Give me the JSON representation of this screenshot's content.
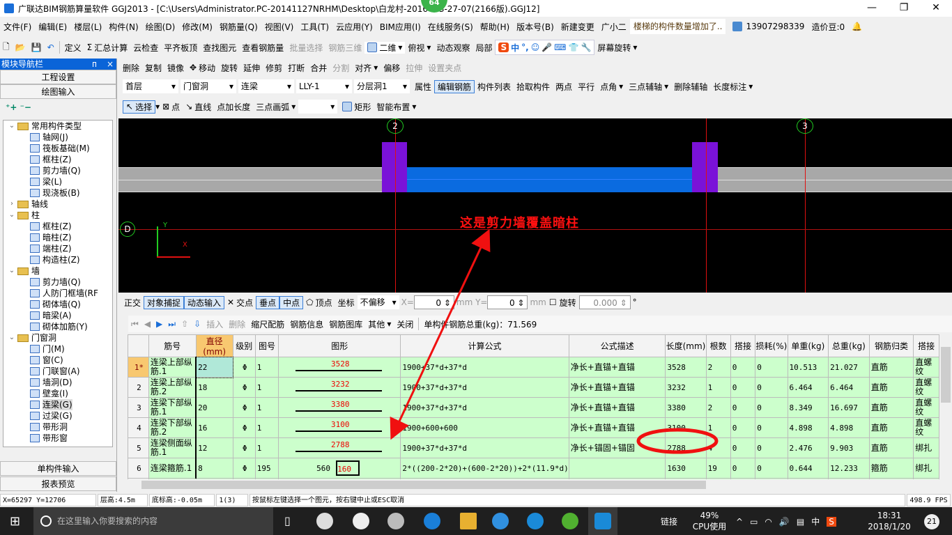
{
  "title": "广联达BIM钢筋算量软件 GGJ2013 - [C:\\Users\\Administrator.PC-20141127NRHM\\Desktop\\白龙村-2016    -13-27-07(2166版).GGJ12]",
  "badge": "64",
  "menu": [
    "文件(F)",
    "编辑(E)",
    "楼层(L)",
    "构件(N)",
    "绘图(D)",
    "修改(M)",
    "钢筋量(Q)",
    "视图(V)",
    "工具(T)",
    "云应用(Y)",
    "BIM应用(I)",
    "在线服务(S)",
    "帮助(H)",
    "版本号(B)",
    "新建变更",
    "广小二"
  ],
  "notice": "楼梯的构件数量增加了..",
  "user": "13907298339",
  "bean": "造价豆:0",
  "toolbar1": [
    "定义",
    "汇总计算",
    "云检查",
    "平齐板顶",
    "查找图元",
    "查看钢筋量",
    "批量选择",
    "钢筋三维",
    "二维",
    "俯视",
    "动态观察",
    "局部",
    "屏幕旋转"
  ],
  "ime": [
    "中",
    "°,"
  ],
  "toolbar2": [
    "删除",
    "复制",
    "镜像",
    "移动",
    "旋转",
    "延伸",
    "修剪",
    "打断",
    "合并",
    "分割",
    "对齐",
    "偏移",
    "拉伸",
    "设置夹点"
  ],
  "selectors": [
    "首层",
    "门窗洞",
    "连梁",
    "LLY-1",
    "分层洞1"
  ],
  "toolbar3": [
    "属性",
    "编辑钢筋",
    "构件列表",
    "拾取构件",
    "两点",
    "平行",
    "点角",
    "三点辅轴",
    "删除辅轴",
    "长度标注"
  ],
  "toolbar4": [
    "选择",
    "点",
    "直线",
    "点加长度",
    "三点画弧",
    "矩形",
    "智能布置"
  ],
  "nav": {
    "title": "模块导航栏",
    "pin": "ᴨ",
    "close": "×",
    "btn1": "工程设置",
    "btn2": "绘图输入",
    "btn3": "单构件输入",
    "btn4": "报表预览",
    "tree": [
      {
        "t": "常用构件类型",
        "lv": 0,
        "folder": true,
        "open": true
      },
      {
        "t": "轴网(J)",
        "lv": 1
      },
      {
        "t": "筏板基础(M)",
        "lv": 1
      },
      {
        "t": "框柱(Z)",
        "lv": 1
      },
      {
        "t": "剪力墙(Q)",
        "lv": 1
      },
      {
        "t": "梁(L)",
        "lv": 1
      },
      {
        "t": "现浇板(B)",
        "lv": 1
      },
      {
        "t": "轴线",
        "lv": 0,
        "folder": true,
        "open": false
      },
      {
        "t": "柱",
        "lv": 0,
        "folder": true,
        "open": true
      },
      {
        "t": "框柱(Z)",
        "lv": 1
      },
      {
        "t": "暗柱(Z)",
        "lv": 1
      },
      {
        "t": "端柱(Z)",
        "lv": 1
      },
      {
        "t": "构造柱(Z)",
        "lv": 1
      },
      {
        "t": "墙",
        "lv": 0,
        "folder": true,
        "open": true
      },
      {
        "t": "剪力墙(Q)",
        "lv": 1
      },
      {
        "t": "人防门框墙(RF",
        "lv": 1
      },
      {
        "t": "砌体墙(Q)",
        "lv": 1
      },
      {
        "t": "暗梁(A)",
        "lv": 1
      },
      {
        "t": "砌体加筋(Y)",
        "lv": 1
      },
      {
        "t": "门窗洞",
        "lv": 0,
        "folder": true,
        "open": true
      },
      {
        "t": "门(M)",
        "lv": 1
      },
      {
        "t": "窗(C)",
        "lv": 1
      },
      {
        "t": "门联窗(A)",
        "lv": 1
      },
      {
        "t": "墙洞(D)",
        "lv": 1
      },
      {
        "t": "壁龛(I)",
        "lv": 1
      },
      {
        "t": "连梁(G)",
        "lv": 1,
        "selected": true
      },
      {
        "t": "过梁(G)",
        "lv": 1
      },
      {
        "t": "带形洞",
        "lv": 1
      },
      {
        "t": "带形窗",
        "lv": 1
      }
    ]
  },
  "canvas": {
    "axis_top": [
      "2",
      "3"
    ],
    "axis_left": "D",
    "ucs_y": "Y",
    "ucs_x": "X",
    "annotation": "这是剪力墙覆盖暗柱"
  },
  "snap": {
    "items": [
      "正交",
      "对象捕捉",
      "动态输入",
      "交点",
      "垂点",
      "中点",
      "顶点",
      "坐标"
    ],
    "offset": "不偏移",
    "x_label": "X=",
    "x": "0",
    "y_label": "mm Y=",
    "y": "0",
    "unit": "mm",
    "rotate": "旋转",
    "angle": "0.000",
    "deg": "°"
  },
  "rebar_toolbar": {
    "items": [
      "插入",
      "删除",
      "缩尺配筋",
      "钢筋信息",
      "钢筋图库",
      "其他",
      "关闭"
    ],
    "total": "单构件钢筋总重(kg)：71.569"
  },
  "table": {
    "headers": [
      "",
      "筋号",
      "直径(mm)",
      "级别",
      "图号",
      "图形",
      "计算公式",
      "公式描述",
      "长度(mm)",
      "根数",
      "搭接",
      "损耗(%)",
      "单重(kg)",
      "总重(kg)",
      "钢筋归类",
      "搭接"
    ],
    "rows": [
      [
        "1*",
        "连梁上部纵筋.1",
        "22",
        "Φ",
        "1",
        "3528",
        "1900+37*d+37*d",
        "净长+直锚+直锚",
        "3528",
        "2",
        "0",
        "0",
        "10.513",
        "21.027",
        "直筋",
        "直螺纹"
      ],
      [
        "2",
        "连梁上部纵筋.2",
        "18",
        "Φ",
        "1",
        "3232",
        "1900+37*d+37*d",
        "净长+直锚+直锚",
        "3232",
        "1",
        "0",
        "0",
        "6.464",
        "6.464",
        "直筋",
        "直螺纹"
      ],
      [
        "3",
        "连梁下部纵筋.1",
        "20",
        "Φ",
        "1",
        "3380",
        "1900+37*d+37*d",
        "净长+直锚+直锚",
        "3380",
        "2",
        "0",
        "0",
        "8.349",
        "16.697",
        "直筋",
        "直螺纹"
      ],
      [
        "4",
        "连梁下部纵筋.2",
        "16",
        "Φ",
        "1",
        "3100",
        "1900+600+600",
        "净长+直锚+直锚",
        "3100",
        "1",
        "0",
        "0",
        "4.898",
        "4.898",
        "直筋",
        "直螺纹"
      ],
      [
        "5",
        "连梁侧面纵筋.1",
        "12",
        "Φ",
        "1",
        "2788",
        "1900+37*d+37*d",
        "净长+锚固+锚固",
        "2788",
        "4",
        "0",
        "0",
        "2.476",
        "9.903",
        "直筋",
        "绑扎"
      ],
      [
        "6",
        "连梁箍筋.1",
        "8",
        "Φ",
        "195",
        "160",
        "2*((200-2*20)+(600-2*20))+2*(11.9*d)",
        "",
        "1630",
        "19",
        "0",
        "0",
        "0.644",
        "12.233",
        "箍筋",
        "绑扎"
      ]
    ],
    "stirrup_side": "560"
  },
  "status": [
    "X=65297 Y=12706",
    "层高:4.5m",
    "底标高:-0.05m",
    "1(3)",
    "按鼠标左键选择一个图元，按右键中止或ESC取消",
    "498.9 FPS"
  ],
  "taskbar": {
    "search": "在这里输入你要搜索的内容",
    "link": "链接",
    "cpu": "49%",
    "cpu_label": "CPU使用",
    "lang": "中",
    "time": "18:31",
    "date": "2018/1/20",
    "notif": "21"
  },
  "colors": {
    "canvas": "#000000",
    "beam": "#0a6be0",
    "column": "#7a12d8",
    "wall": "#a8a8a8",
    "axis": "#e01010",
    "grid_bg": "#ccffcc",
    "annotation": "#ff1010"
  }
}
